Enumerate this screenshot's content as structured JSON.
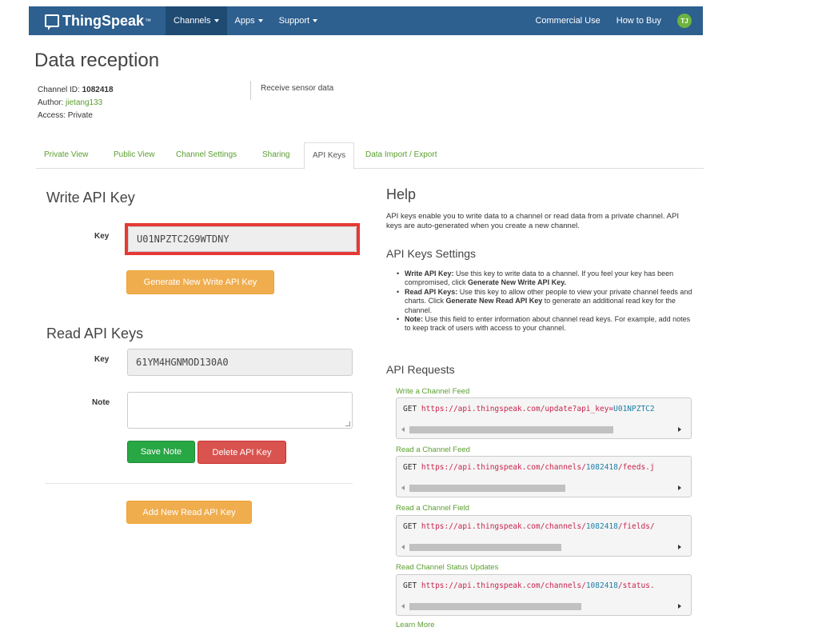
{
  "nav": {
    "brand": "ThingSpeak",
    "brand_tm": "™",
    "channels": "Channels",
    "apps": "Apps",
    "support": "Support",
    "commercial": "Commercial Use",
    "how_to_buy": "How to Buy",
    "avatar": "TJ"
  },
  "page": {
    "title": "Data reception",
    "channel_id_label": "Channel ID: ",
    "channel_id": "1082418",
    "author_label": "Author: ",
    "author": "jietang133",
    "access": "Access: Private",
    "description": "Receive sensor data"
  },
  "tabs": [
    "Private View",
    "Public View",
    "Channel Settings",
    "Sharing",
    "API Keys",
    "Data Import / Export"
  ],
  "write": {
    "heading": "Write API Key",
    "key_label": "Key",
    "key": "U01NPZTC2G9WTDNY",
    "generate_btn": "Generate New Write API Key"
  },
  "read": {
    "heading": "Read API Keys",
    "key_label": "Key",
    "key": "61YM4HGNMOD130A0",
    "note_label": "Note",
    "save_btn": "Save Note",
    "delete_btn": "Delete API Key",
    "add_btn": "Add New Read API Key"
  },
  "help": {
    "heading": "Help",
    "text": "API keys enable you to write data to a channel or read data from a private channel. API keys are auto-generated when you create a new channel.",
    "settings_heading": "API Keys Settings",
    "bullets": [
      {
        "bold": "Write API Key:",
        "text": " Use this key to write data to a channel. If you feel your key has been compromised, click ",
        "bold2": "Generate New Write API Key."
      },
      {
        "bold": "Read API Keys:",
        "text": " Use this key to allow other people to view your private channel feeds and charts. Click ",
        "bold2": "Generate New Read API Key",
        "text2": " to generate an additional read key for the channel."
      },
      {
        "bold": "Note:",
        "text": " Use this field to enter information about channel read keys. For example, add notes to keep track of users with access to your channel."
      }
    ],
    "requests_heading": "API Requests",
    "requests": [
      {
        "label": "Write a Channel Feed",
        "method": "GET",
        "url": "https://api.thingspeak.com/update?api_key=",
        "key": "U01NPZTC2"
      },
      {
        "label": "Read a Channel Feed",
        "method": "GET",
        "url": "https://api.thingspeak.com/channels/",
        "key": "1082418",
        "suffix": "/feeds.j"
      },
      {
        "label": "Read a Channel Field",
        "method": "GET",
        "url": "https://api.thingspeak.com/channels/",
        "key": "1082418",
        "suffix": "/fields/"
      },
      {
        "label": "Read Channel Status Updates",
        "method": "GET",
        "url": "https://api.thingspeak.com/channels/",
        "key": "1082418",
        "suffix": "/status."
      }
    ],
    "learn_more": "Learn More"
  }
}
